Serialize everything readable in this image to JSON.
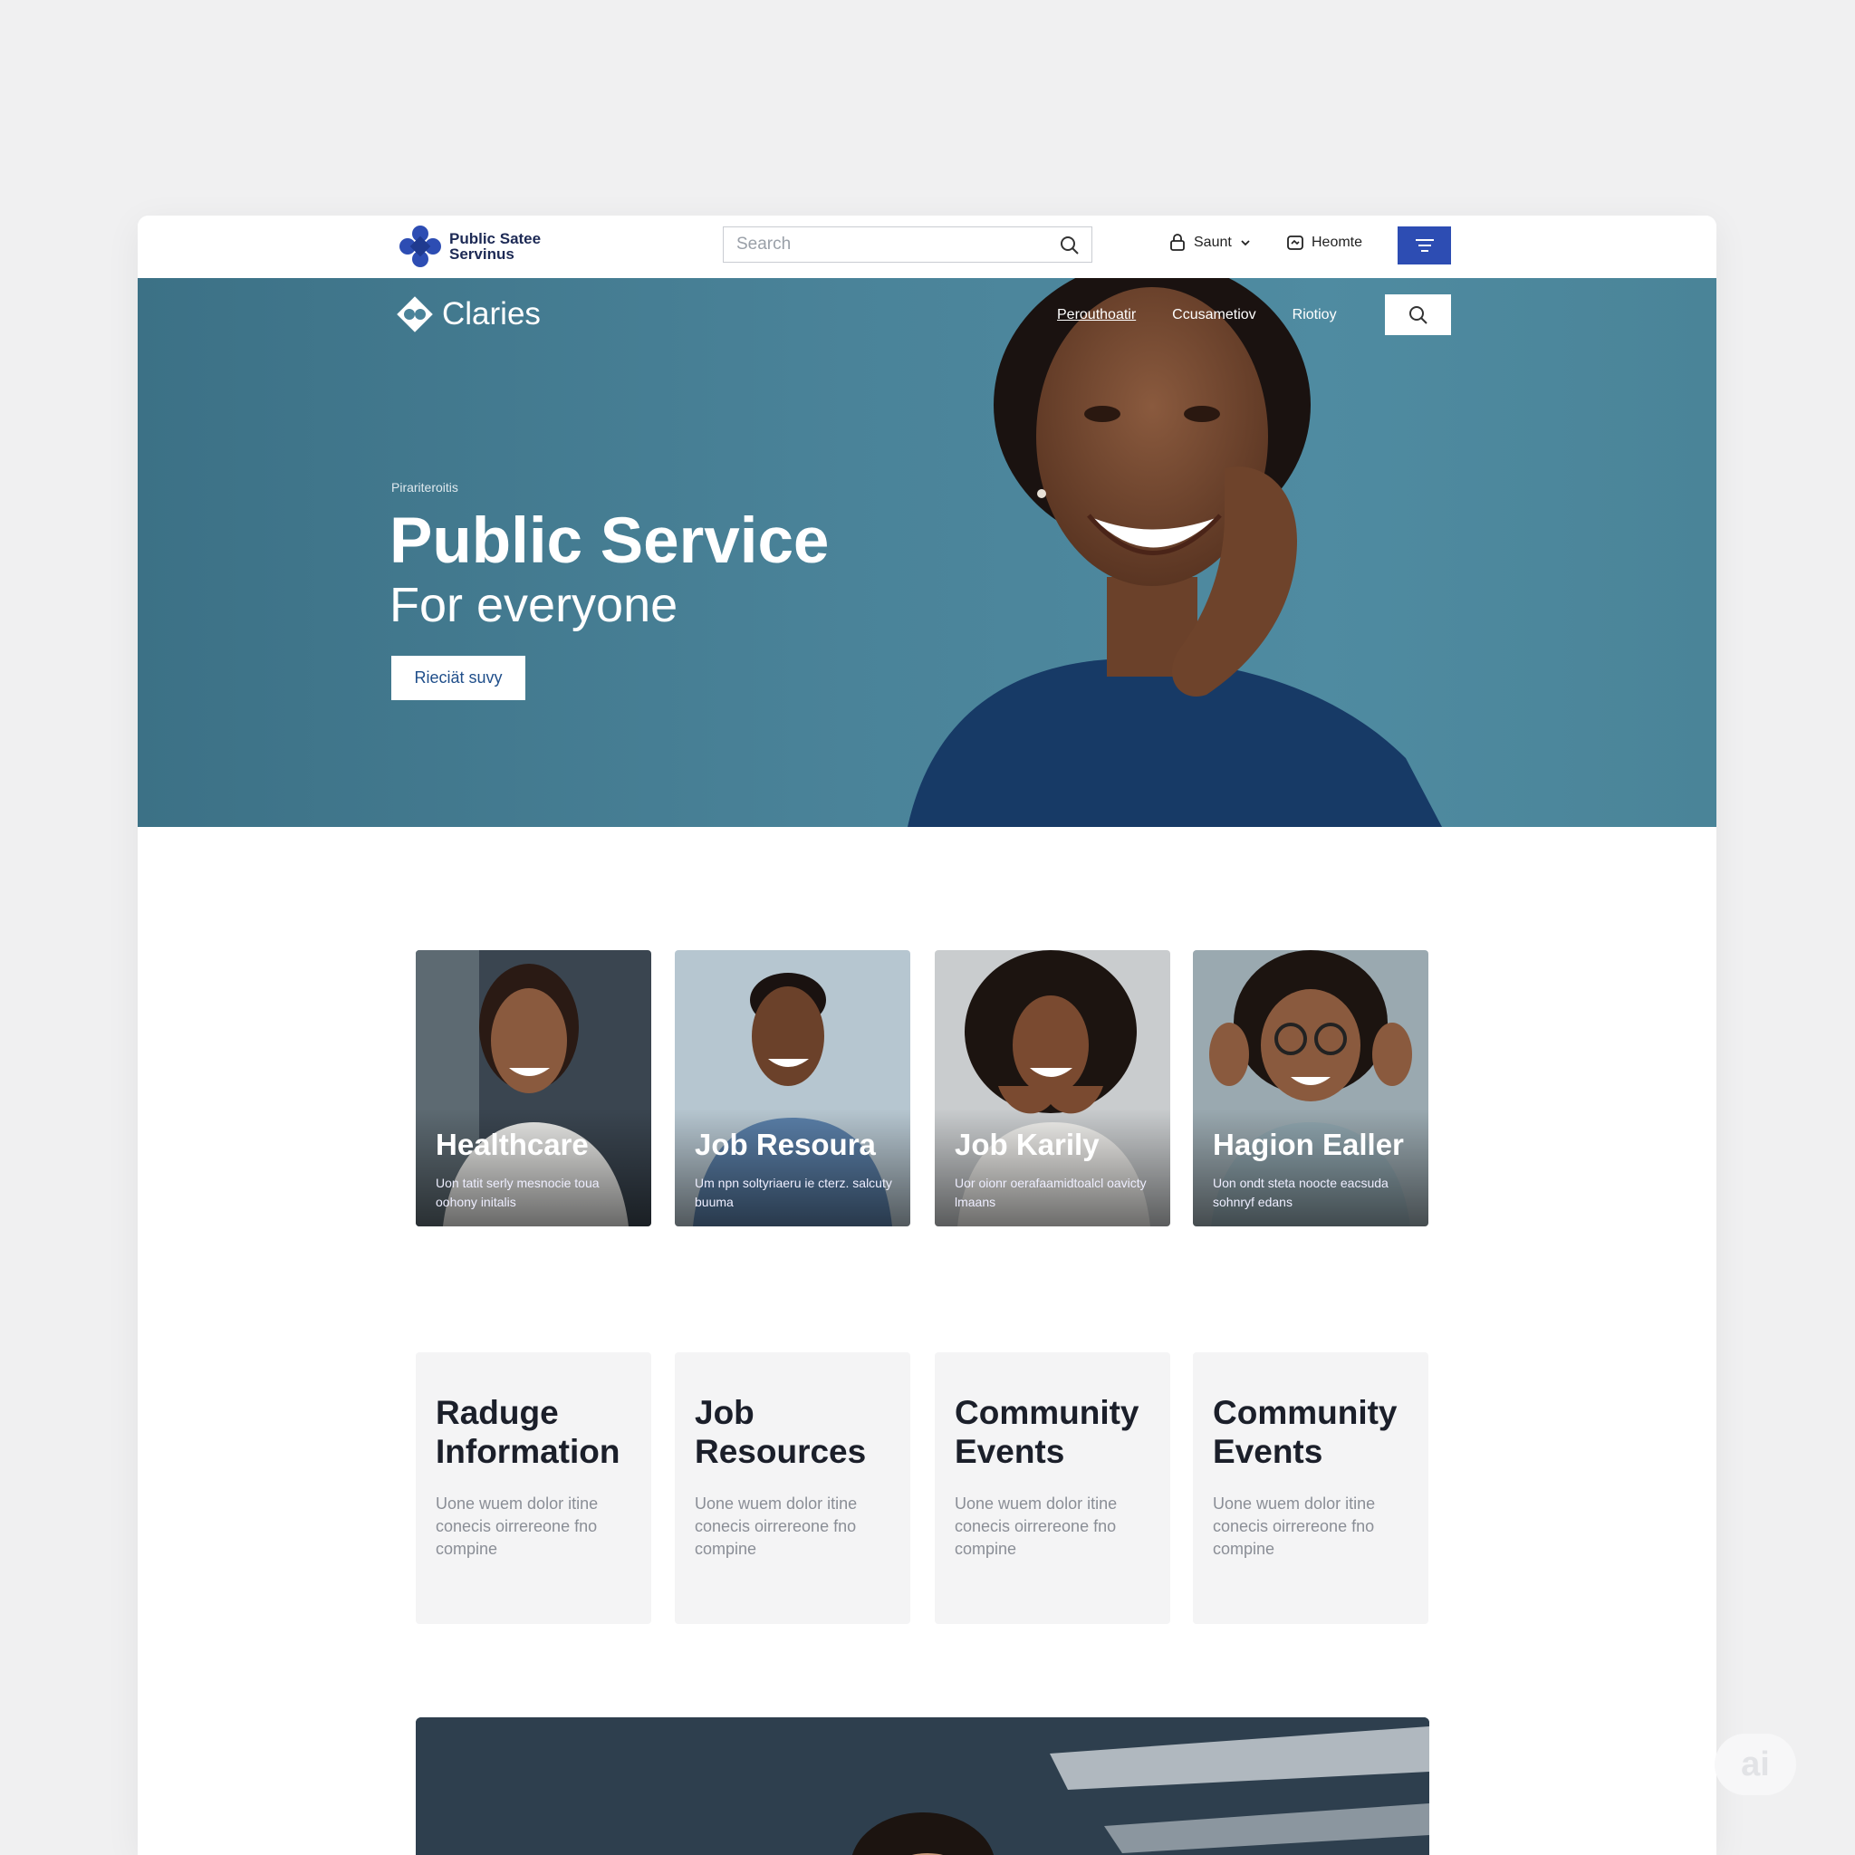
{
  "brand": {
    "line1": "Public Satee",
    "line2": "Servinus"
  },
  "search": {
    "placeholder": "Search"
  },
  "utility": {
    "account_label": "Saunt",
    "home_label": "Heomte"
  },
  "hero": {
    "logo_text": "Claries",
    "nav": [
      "Perouthoatir",
      "Ccusametiov",
      "Riotioy"
    ],
    "eyebrow": "Pirariteroitis",
    "title": "Public Service",
    "subtitle": "For everyone",
    "cta_label": "Rieciät suvy"
  },
  "photo_cards": [
    {
      "title": "Healthcare",
      "desc": "Uon tatit serly mesnocie toua oohony initalis"
    },
    {
      "title": "Job Resoura",
      "desc": "Um npn soltyriaeru ie cterz. salcuty buuma"
    },
    {
      "title": "Job Karily",
      "desc": "Uor oionr oerafaamidtoalcl oavicty lmaans"
    },
    {
      "title": "Hagion Ealler",
      "desc": "Uon ondt steta noocte eacsuda sohnryf edans"
    }
  ],
  "info_cards": [
    {
      "title": "Raduge Information",
      "desc": "Uone wuem dolor itine conecis oirrereone fno compine"
    },
    {
      "title": "Job Resources",
      "desc": "Uone wuem dolor itine conecis oirrereone fno compine"
    },
    {
      "title": "Community Events",
      "desc": "Uone wuem dolor itine conecis oirrereone fno compine"
    },
    {
      "title": "Community Events",
      "desc": "Uone wuem dolor itine conecis oirrereone fno compine"
    }
  ],
  "badge": "ai",
  "colors": {
    "primary": "#2d4db3",
    "hero_bg": "#4a8399",
    "text_dark": "#1b1f2a"
  }
}
